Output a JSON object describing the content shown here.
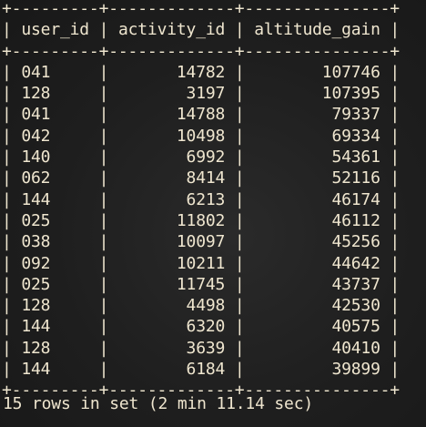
{
  "columns": [
    "user_id",
    "activity_id",
    "altitude_gain"
  ],
  "rows": [
    [
      "041",
      "14782",
      "107746"
    ],
    [
      "128",
      "3197",
      "107395"
    ],
    [
      "041",
      "14788",
      "79337"
    ],
    [
      "042",
      "10498",
      "69334"
    ],
    [
      "140",
      "6992",
      "54361"
    ],
    [
      "062",
      "8414",
      "52116"
    ],
    [
      "144",
      "6213",
      "46174"
    ],
    [
      "025",
      "11802",
      "46112"
    ],
    [
      "038",
      "10097",
      "45256"
    ],
    [
      "092",
      "10211",
      "44642"
    ],
    [
      "025",
      "11745",
      "43737"
    ],
    [
      "128",
      "4498",
      "42530"
    ],
    [
      "144",
      "6320",
      "40575"
    ],
    [
      "128",
      "3639",
      "40410"
    ],
    [
      "144",
      "6184",
      "39899"
    ]
  ],
  "status_line": "15 rows in set (2 min 11.14 sec)"
}
